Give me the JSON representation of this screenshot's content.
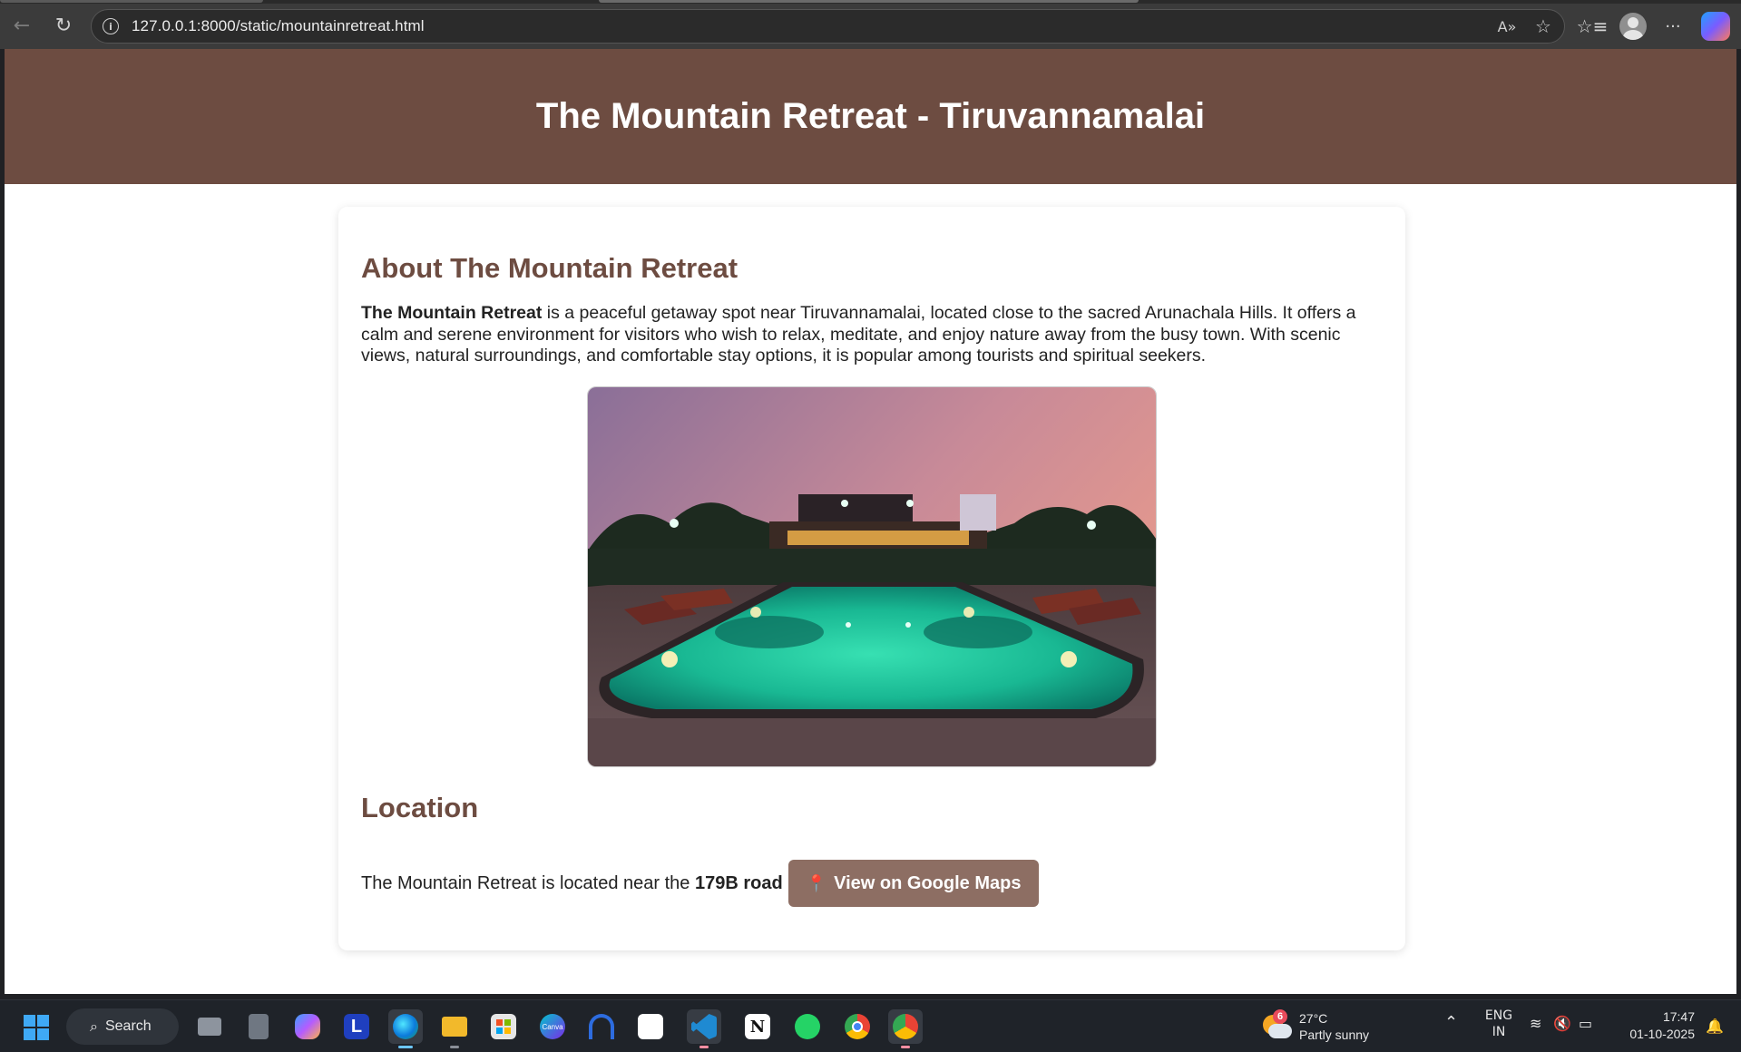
{
  "browser": {
    "url": "127.0.0.1:8000/static/mountainretreat.html",
    "back_icon": "←",
    "reload_icon": "↻",
    "info_icon": "i",
    "read_aloud_icon": "A»",
    "favorite_icon": "☆",
    "favorites_icon": "☆≡",
    "more_icon": "···"
  },
  "page": {
    "header_title": "The Mountain Retreat - Tiruvannamalai",
    "about": {
      "title": "About The Mountain Retreat",
      "name_bold": "The Mountain Retreat",
      "text": " is a peaceful getaway spot near Tiruvannamalai, located close to the sacred Arunachala Hills. It offers a calm and serene environment for visitors who wish to relax, meditate, and enjoy nature away from the busy town. With scenic views, natural surroundings, and comfortable stay options, it is popular among tourists and spiritual seekers."
    },
    "location": {
      "title": "Location",
      "text_prefix": "The Mountain Retreat is located near the ",
      "road": "179B road",
      "maps_button": "View on Google Maps",
      "pin_icon": "📍"
    }
  },
  "taskbar": {
    "search_label": "Search",
    "apps": [
      "task-view",
      "calculator",
      "copilot",
      "l-app",
      "edge",
      "file-explorer",
      "microsoft-store",
      "canva",
      "headphones-app",
      "capcut",
      "vscode",
      "notion",
      "whatsapp",
      "chrome",
      "chrome-profile"
    ],
    "l_app_label": "L",
    "canva_label": "Canva",
    "notion_label": "N",
    "weather": {
      "badge": "6",
      "temp": "27°C",
      "condition": "Partly sunny"
    },
    "lang_top": "ENG",
    "lang_bottom": "IN",
    "time": "17:47",
    "date": "01-10-2025"
  },
  "colors": {
    "header_brown": "#6d4c41",
    "button_brown": "#8d6e63",
    "heading_brown": "#6d4c41"
  }
}
